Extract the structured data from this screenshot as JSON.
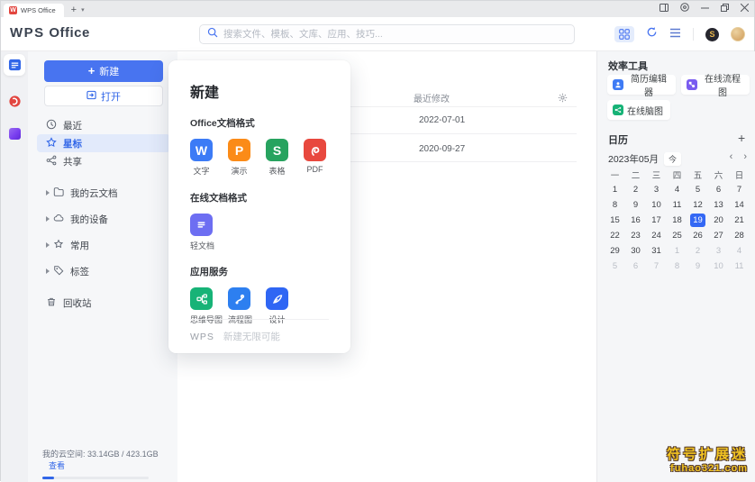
{
  "window": {
    "tab_title": "WPS Office",
    "new_tab_label": "+"
  },
  "header": {
    "logo": "WPS Office",
    "search_placeholder": "搜索文件、模板、文库、应用、技巧..."
  },
  "sidebar": {
    "new_label": "新建",
    "open_label": "打开",
    "nav": [
      {
        "label": "最近"
      },
      {
        "label": "星标"
      },
      {
        "label": "共享"
      },
      {
        "label": "我的云文档"
      },
      {
        "label": "我的设备"
      },
      {
        "label": "常用"
      },
      {
        "label": "标签"
      },
      {
        "label": "回收站"
      }
    ],
    "storage": {
      "label": "我的云空间:",
      "usage": "33.14GB / 423.1GB",
      "view": "查看"
    }
  },
  "newdoc": {
    "title": "新建",
    "section_office": "Office文档格式",
    "office": [
      {
        "label": "文字",
        "glyph": "W",
        "color": "#3c7bf6"
      },
      {
        "label": "演示",
        "glyph": "P",
        "color": "#fb8b18"
      },
      {
        "label": "表格",
        "glyph": "S",
        "color": "#27a35f"
      },
      {
        "label": "PDF",
        "glyph": "",
        "color": "#e8483e"
      }
    ],
    "section_online": "在线文档格式",
    "online": [
      {
        "label": "轻文档",
        "color": "#6d6ef2"
      }
    ],
    "section_apps": "应用服务",
    "apps": [
      {
        "label": "思维导图",
        "color": "#17b377"
      },
      {
        "label": "流程图",
        "color": "#2d7ff0"
      },
      {
        "label": "设计",
        "color": "#2f66f4"
      }
    ],
    "footer_brand": "WPS",
    "footer_text": "新建无限可能"
  },
  "main": {
    "modified_column": "最近修改",
    "rows": [
      {
        "modified": "2022-07-01"
      },
      {
        "modified": "2020-09-27"
      }
    ]
  },
  "tools": {
    "title": "效率工具",
    "items": [
      {
        "label": "简历编辑器",
        "color": "#3e7bf5"
      },
      {
        "label": "在线流程图",
        "color": "#7a5cf0"
      },
      {
        "label": "在线脑图",
        "color": "#17b377"
      }
    ]
  },
  "calendar": {
    "title": "日历",
    "month": "2023年05月",
    "today": "今",
    "weekdays": [
      "一",
      "二",
      "三",
      "四",
      "五",
      "六",
      "日"
    ],
    "days": [
      {
        "v": "1"
      },
      {
        "v": "2"
      },
      {
        "v": "3"
      },
      {
        "v": "4"
      },
      {
        "v": "5"
      },
      {
        "v": "6"
      },
      {
        "v": "7"
      },
      {
        "v": "8"
      },
      {
        "v": "9"
      },
      {
        "v": "10"
      },
      {
        "v": "11"
      },
      {
        "v": "12"
      },
      {
        "v": "13"
      },
      {
        "v": "14"
      },
      {
        "v": "15"
      },
      {
        "v": "16"
      },
      {
        "v": "17"
      },
      {
        "v": "18"
      },
      {
        "v": "19",
        "s": true
      },
      {
        "v": "20"
      },
      {
        "v": "21"
      },
      {
        "v": "22"
      },
      {
        "v": "23"
      },
      {
        "v": "24"
      },
      {
        "v": "25"
      },
      {
        "v": "26"
      },
      {
        "v": "27"
      },
      {
        "v": "28"
      },
      {
        "v": "29"
      },
      {
        "v": "30"
      },
      {
        "v": "31"
      },
      {
        "v": "1",
        "m": true
      },
      {
        "v": "2",
        "m": true
      },
      {
        "v": "3",
        "m": true
      },
      {
        "v": "4",
        "m": true
      },
      {
        "v": "5",
        "m": true
      },
      {
        "v": "6",
        "m": true
      },
      {
        "v": "7",
        "m": true
      },
      {
        "v": "8",
        "m": true
      },
      {
        "v": "9",
        "m": true
      },
      {
        "v": "10",
        "m": true
      },
      {
        "v": "11",
        "m": true
      }
    ]
  },
  "watermark": {
    "line1": "符号扩展迷",
    "line2": "fuhao321.com"
  },
  "colors": {
    "accent": "#3166e8",
    "new_button": "#4874f0",
    "calendar_selected": "#3468f4"
  }
}
